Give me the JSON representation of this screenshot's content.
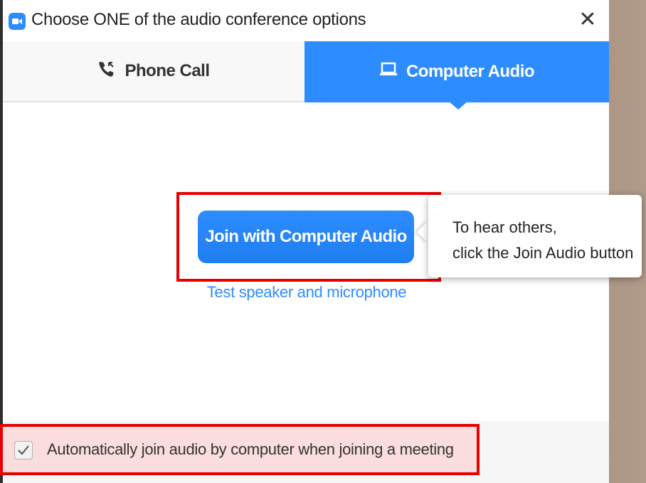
{
  "dialog": {
    "title": "Choose ONE of the audio conference options",
    "close_glyph": "✕"
  },
  "tabs": [
    {
      "label": "Phone Call",
      "icon": "phone-icon",
      "selected": false
    },
    {
      "label": "Computer Audio",
      "icon": "laptop-icon",
      "selected": true
    }
  ],
  "main": {
    "join_button_label": "Join with Computer Audio",
    "test_link_label": "Test speaker and microphone",
    "tooltip_line1": "To hear others,",
    "tooltip_line2": "click the Join Audio button"
  },
  "footer": {
    "auto_join_label": "Automatically join audio by computer when joining a meeting",
    "auto_join_checked": true
  },
  "colors": {
    "accent": "#2d8cff",
    "highlight": "#e60000"
  }
}
